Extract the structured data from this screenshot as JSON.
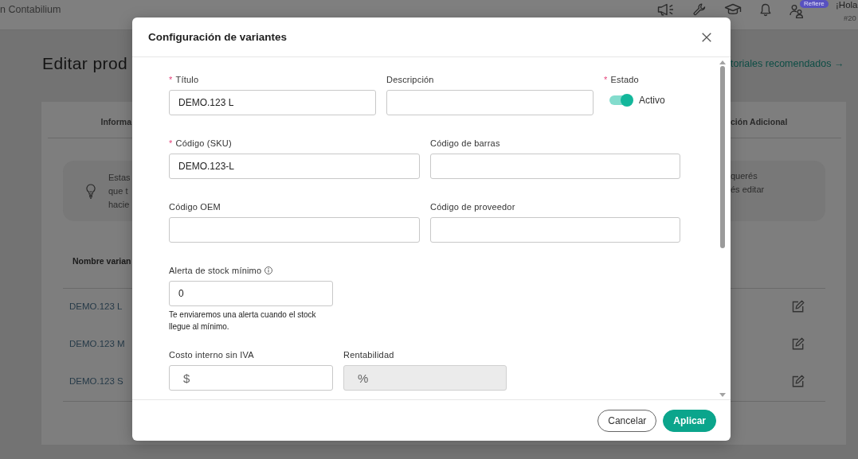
{
  "top_bar": {
    "brand": "n Contabilium",
    "tag": "Refiere",
    "greeting": "¡Hola",
    "account": "#20"
  },
  "page": {
    "title": "Editar prod",
    "link": "toriales recomendados →"
  },
  "tabs": [
    {
      "label": "Informa",
      "selected": false
    },
    {
      "label": "ción Adicional",
      "selected": false
    }
  ],
  "tip": {
    "left_lines": [
      "Estas",
      "que t",
      "hacie"
    ],
    "right_lines": [
      "querés",
      "és editar"
    ]
  },
  "variants_table": {
    "columns": [
      "Nombre varian"
    ],
    "rows": [
      {
        "name": "DEMO.123 L"
      },
      {
        "name": "DEMO.123 M"
      },
      {
        "name": "DEMO.123 S"
      }
    ]
  },
  "modal": {
    "title": "Configuración de variantes",
    "rows": [
      {
        "fields": [
          {
            "kind": "text",
            "label": "Título",
            "mark": "*",
            "value": "DEMO.123 L",
            "disabled": false
          },
          {
            "kind": "text",
            "label": "Descripción",
            "disabled": false
          },
          {
            "kind": "toggle",
            "label": "Estado",
            "mark": "*",
            "on": true,
            "text": "Activo"
          }
        ]
      },
      {
        "fields": [
          {
            "kind": "text",
            "label": "Código (SKU)",
            "mark": "*",
            "value": "DEMO.123-L",
            "disabled": false
          },
          {
            "kind": "text",
            "label": "Código de barras",
            "disabled": false
          }
        ]
      },
      {
        "fields": [
          {
            "kind": "text",
            "label": "Código OEM",
            "disabled": false
          },
          {
            "kind": "text",
            "label": "Código de proveedor",
            "disabled": false
          }
        ]
      },
      {
        "fields": [
          {
            "kind": "text",
            "label": "Alerta de stock mínimo",
            "info": true,
            "value": "0",
            "help": "Te enviaremos una alerta cuando el stock llegue al mínimo.",
            "disabled": false
          }
        ]
      },
      {
        "fields": [
          {
            "kind": "text",
            "label": "Costo interno sin IVA",
            "prefix": "$",
            "disabled": false
          },
          {
            "kind": "text",
            "label": "Rentabilidad",
            "prefix": "%",
            "disabled": true
          }
        ]
      }
    ],
    "buttons": [
      {
        "label": "Cancelar",
        "kind": "secondary"
      },
      {
        "label": "Aplicar",
        "kind": "primary"
      }
    ]
  }
}
